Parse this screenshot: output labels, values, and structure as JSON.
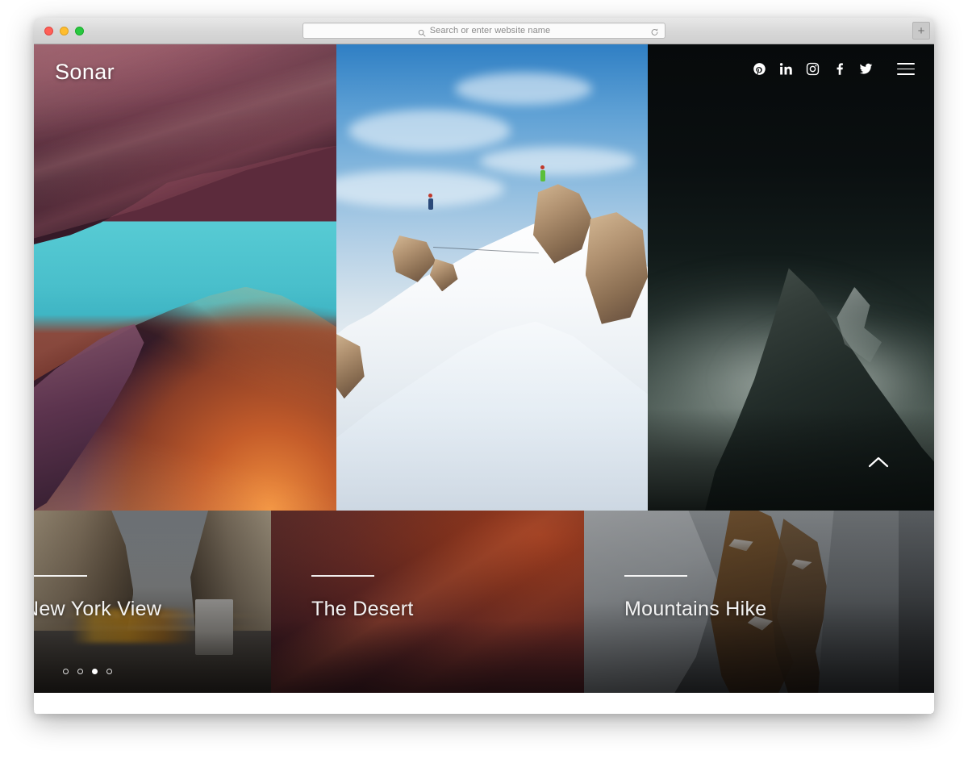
{
  "browser": {
    "traffic_lights": [
      "close",
      "minimize",
      "maximize"
    ],
    "address_placeholder": "Search or enter website name",
    "search_icon": "search-icon",
    "reload_icon": "reload-icon",
    "new_tab_label": "+"
  },
  "site": {
    "logo": "Sonar",
    "social": [
      {
        "name": "pinterest",
        "label": "Pinterest"
      },
      {
        "name": "linkedin",
        "label": "LinkedIn"
      },
      {
        "name": "instagram",
        "label": "Instagram"
      },
      {
        "name": "facebook",
        "label": "Facebook"
      },
      {
        "name": "twitter",
        "label": "Twitter"
      }
    ],
    "menu_label": "Menu",
    "scroll_up_label": "Scroll up"
  },
  "hero": {
    "panels": [
      {
        "name": "slot-canyon",
        "alt": "Antelope slot canyon with turquoise sky"
      },
      {
        "name": "snow-ridge",
        "alt": "Climbers on a snowy mountain ridge"
      },
      {
        "name": "dark-peak",
        "alt": "Dark misty mountain peak"
      }
    ]
  },
  "cards": [
    {
      "title": "New York View",
      "image": "new-york-street"
    },
    {
      "title": "The Desert",
      "image": "red-desert-dunes"
    },
    {
      "title": "Mountains Hike",
      "image": "rocky-snow-mountain"
    }
  ],
  "carousel": {
    "total": 4,
    "active_index": 2
  },
  "colors": {
    "accent_white": "#ffffff",
    "canyon_sky": "#49bfcb",
    "desert_red": "#7b2f1c",
    "chrome_gray": "#d8d8d8"
  }
}
